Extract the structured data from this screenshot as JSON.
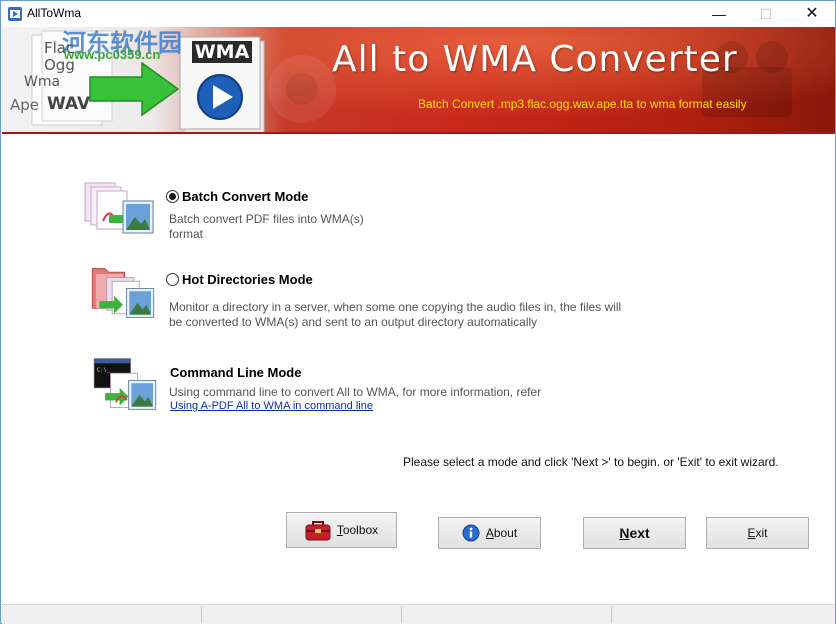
{
  "window": {
    "title": "AllToWma"
  },
  "window_controls": {
    "minimize": "—",
    "maximize": "☐",
    "close": "✕"
  },
  "banner": {
    "title": "All to WMA Converter",
    "subtitle": "Batch Convert .mp3.flac.ogg.wav.ape.tta to wma  format easily",
    "formats": {
      "flac": "Flac",
      "ogg": "Ogg",
      "wma": "Wma",
      "ape": "Ape",
      "wav": "WAV"
    },
    "badge": "WMA",
    "watermark": "河东软件园",
    "watermark_url": "www.pc0359.cn"
  },
  "modes": [
    {
      "title": "Batch Convert Mode",
      "selected": true,
      "desc_line1": "Batch convert PDF files into WMA(s)",
      "desc_line2": "format"
    },
    {
      "title": "Hot Directories Mode",
      "selected": false,
      "desc_line1": "Monitor a directory in a server, when some one copying the audio files in, the files will",
      "desc_line2": "be converted to WMA(s) and sent to an output directory automatically"
    },
    {
      "title": "Command Line Mode",
      "desc_line1": "Using command line to convert All to WMA, for more information, refer",
      "link": "Using A-PDF All to WMA in command line"
    }
  ],
  "hint": "Please select a mode and click 'Next >' to begin. or 'Exit' to exit wizard.",
  "buttons": {
    "toolbox_mnemonic": "T",
    "toolbox_rest": "oolbox",
    "about_mnemonic": "A",
    "about_rest": "bout",
    "next_mnemonic": "N",
    "next_rest": "ext",
    "exit_mnemonic": "E",
    "exit_rest": "xit"
  },
  "colors": {
    "banner_red": "#c9281a",
    "subtitle_yellow": "#ffe100",
    "link_blue": "#0a2ea8"
  }
}
